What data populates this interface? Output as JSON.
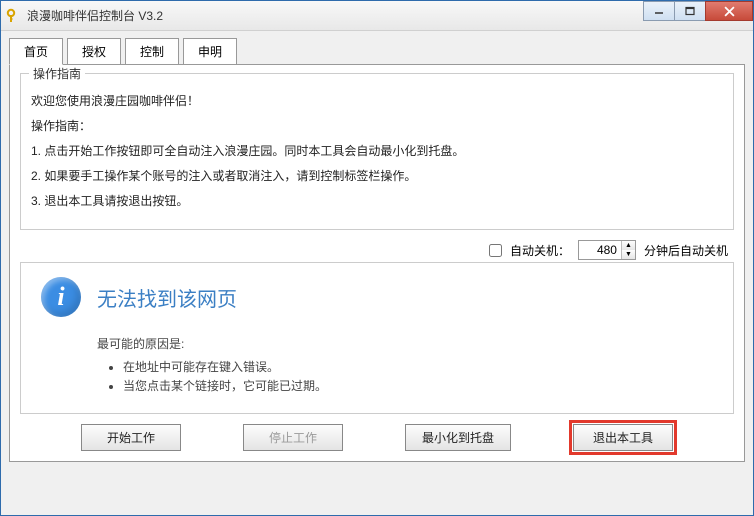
{
  "window": {
    "title": "浪漫咖啡伴侣控制台 V3.2"
  },
  "tabs": [
    "首页",
    "授权",
    "控制",
    "申明"
  ],
  "group": {
    "legend": "操作指南",
    "welcome": "欢迎您使用浪漫庄园咖啡伴侣！",
    "guide_title": "操作指南：",
    "step1": "1. 点击开始工作按钮即可全自动注入浪漫庄园。同时本工具会自动最小化到托盘。",
    "step2": "2. 如果要手工操作某个账号的注入或者取消注入，请到控制标签栏操作。",
    "step3": "3. 退出本工具请按退出按钮。"
  },
  "shutdown": {
    "label": "自动关机：",
    "value": "480",
    "suffix": "分钟后自动关机"
  },
  "error": {
    "title": "无法找到该网页",
    "reason_heading": "最可能的原因是:",
    "reason1": "在地址中可能存在键入错误。",
    "reason2": "当您点击某个链接时，它可能已过期。"
  },
  "buttons": {
    "start": "开始工作",
    "stop": "停止工作",
    "minimize": "最小化到托盘",
    "exit": "退出本工具"
  }
}
